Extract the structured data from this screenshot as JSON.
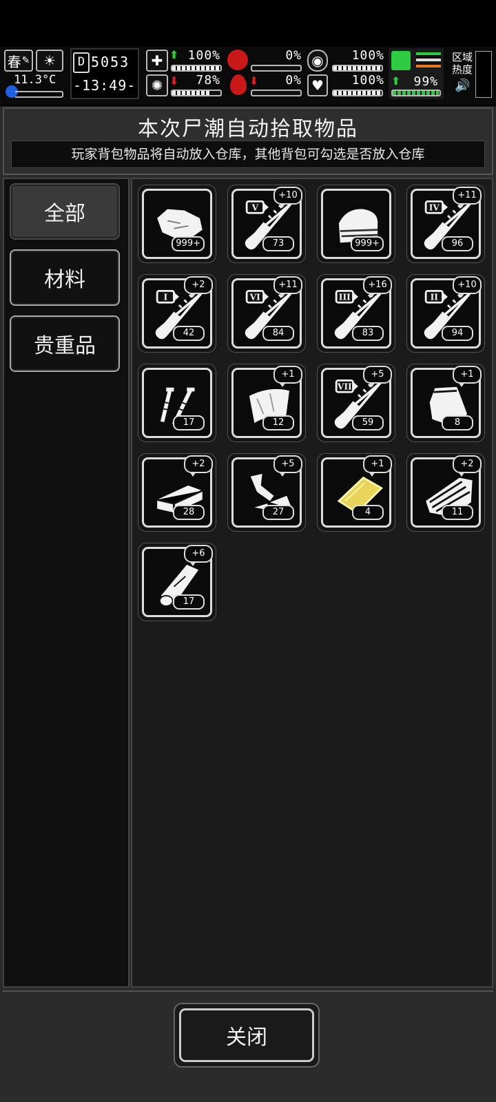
{
  "hud": {
    "season": "春",
    "temperature": "11.3°C",
    "day_counter": "5053",
    "clock": "-13:49-",
    "stats": {
      "health": "100%",
      "hunger": "0%",
      "mood": "100%",
      "stamina": "99%",
      "disease": "78%",
      "thirst": "0%",
      "heart": "100%"
    },
    "stat_levels": {
      "health": 1.0,
      "hunger": 0.0,
      "mood": 1.0,
      "stamina": 0.99,
      "disease": 0.78,
      "thirst": 0.0,
      "heart": 1.0
    },
    "region_heat_label": "区域热度",
    "colors": {
      "up": "#27d43a",
      "down": "#e31d1d",
      "stamina_icon": "#2ecc40",
      "stripe_orange": "#e77a1e"
    }
  },
  "dialog": {
    "title": "本次尸潮自动拾取物品",
    "subtitle": "玩家背包物品将自动放入仓库，其他背包可勾选是否放入仓库",
    "tabs": [
      {
        "label": "全部",
        "active": true
      },
      {
        "label": "材料",
        "active": false
      },
      {
        "label": "贵重品",
        "active": false
      }
    ],
    "items": [
      {
        "icon": "cloth-scrap-icon",
        "count": "999+",
        "bonus": ""
      },
      {
        "icon": "test-tube-v-icon",
        "count": "73",
        "bonus": "+10",
        "roman": "V"
      },
      {
        "icon": "folded-cloth-icon",
        "count": "999+",
        "bonus": ""
      },
      {
        "icon": "test-tube-iv-icon",
        "count": "96",
        "bonus": "+11",
        "roman": "IV"
      },
      {
        "icon": "test-tube-i-icon",
        "count": "42",
        "bonus": "+2",
        "roman": "I"
      },
      {
        "icon": "test-tube-vi-icon",
        "count": "84",
        "bonus": "+11",
        "roman": "VI"
      },
      {
        "icon": "test-tube-iii-icon",
        "count": "83",
        "bonus": "+16",
        "roman": "III"
      },
      {
        "icon": "test-tube-ii-icon",
        "count": "94",
        "bonus": "+10",
        "roman": "II"
      },
      {
        "icon": "screws-icon",
        "count": "17",
        "bonus": ""
      },
      {
        "icon": "metal-sheet-icon",
        "count": "12",
        "bonus": "+1"
      },
      {
        "icon": "test-tube-vii-icon",
        "count": "59",
        "bonus": "+5",
        "roman": "VII"
      },
      {
        "icon": "plastic-bag-icon",
        "count": "8",
        "bonus": "+1"
      },
      {
        "icon": "stone-brick-icon",
        "count": "28",
        "bonus": "+2"
      },
      {
        "icon": "metal-scraps-icon",
        "count": "27",
        "bonus": "+5"
      },
      {
        "icon": "gold-plate-icon",
        "count": "4",
        "bonus": "+1"
      },
      {
        "icon": "wood-planks-icon",
        "count": "11",
        "bonus": "+2"
      },
      {
        "icon": "wood-log-icon",
        "count": "17",
        "bonus": "+6"
      }
    ],
    "close_label": "关闭"
  }
}
